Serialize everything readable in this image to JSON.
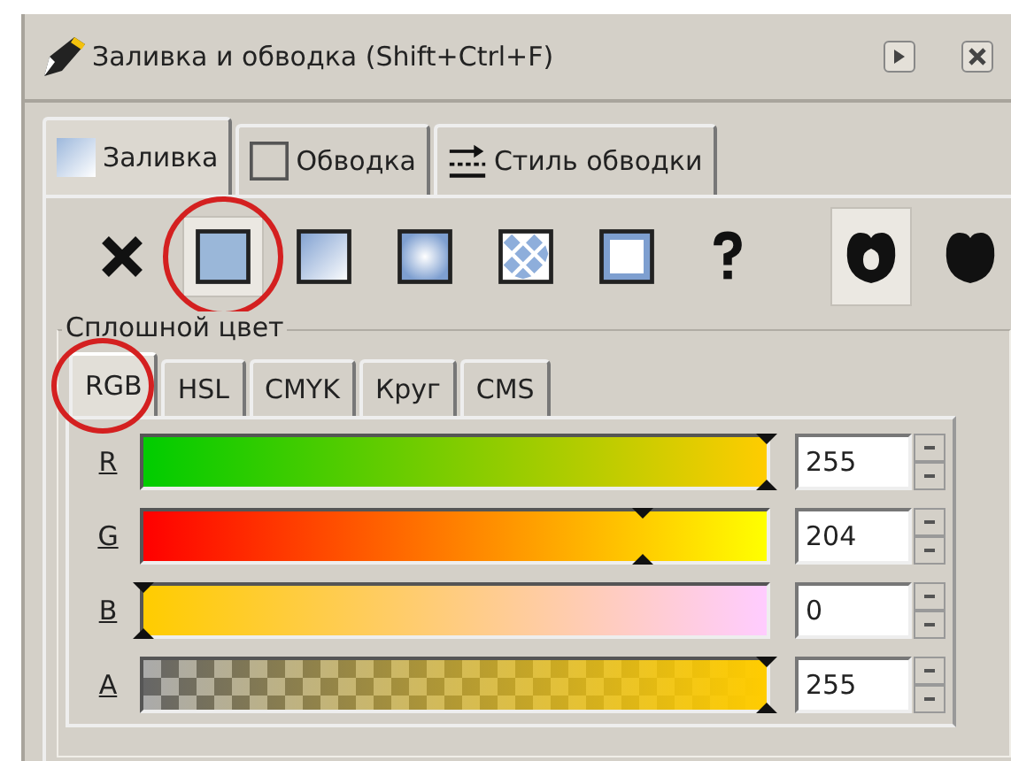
{
  "window": {
    "title": "Заливка и обводка (Shift+Ctrl+F)"
  },
  "tabs": [
    {
      "label": "Заливка",
      "kind": "fill",
      "selected": true
    },
    {
      "label": "Обводка",
      "kind": "stroke",
      "selected": false
    },
    {
      "label": "Стиль обводки",
      "kind": "style",
      "selected": false
    }
  ],
  "fill_types": [
    {
      "kind": "none",
      "selected": false,
      "highlighted": false
    },
    {
      "kind": "flat",
      "selected": true,
      "highlighted": true
    },
    {
      "kind": "linear",
      "selected": false,
      "highlighted": false
    },
    {
      "kind": "radial",
      "selected": false,
      "highlighted": false
    },
    {
      "kind": "pattern",
      "selected": false,
      "highlighted": false
    },
    {
      "kind": "swatch",
      "selected": false,
      "highlighted": false
    },
    {
      "kind": "unset",
      "selected": false,
      "highlighted": false
    }
  ],
  "fill_rules": [
    {
      "kind": "evenodd",
      "selected": true
    },
    {
      "kind": "nonzero",
      "selected": false
    }
  ],
  "color_frame": {
    "title": "Сплошной цвет",
    "tabs": [
      {
        "label": "RGB",
        "selected": true,
        "highlighted": true
      },
      {
        "label": "HSL",
        "selected": false,
        "highlighted": false
      },
      {
        "label": "CMYK",
        "selected": false,
        "highlighted": false
      },
      {
        "label": "Круг",
        "selected": false,
        "highlighted": false
      },
      {
        "label": "CMS",
        "selected": false,
        "highlighted": false
      }
    ],
    "channels": [
      {
        "label": "R",
        "kind": "red",
        "level": 1,
        "value": "255"
      },
      {
        "label": "G",
        "kind": "green",
        "level": 0.8,
        "value": "204"
      },
      {
        "label": "B",
        "kind": "blue",
        "level": 0,
        "value": "0"
      },
      {
        "label": "A",
        "kind": "alpha",
        "level": 1,
        "value": "255"
      }
    ]
  }
}
